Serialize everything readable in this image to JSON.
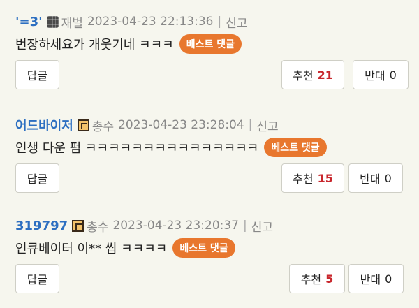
{
  "comments": [
    {
      "nick": "'=3'",
      "level_icon": "dark-grid-icon",
      "grade": "재벌",
      "date": "2023-04-23 22:13:36",
      "report": "신고",
      "text": "번장하세요가 개웃기네 ㅋㅋㅋ",
      "badge": "베스트 댓글",
      "reply": "답글",
      "up_label": "추천",
      "up_count": "21",
      "down_label": "반대",
      "down_count": "0"
    },
    {
      "nick": "어드바이저",
      "level_icon": "square-bracket-icon",
      "grade": "총수",
      "date": "2023-04-23 23:28:04",
      "report": "신고",
      "text": "인생 다운 펌 ㅋㅋㅋㅋㅋㅋㅋㅋㅋㅋㅋㅋㅋㅋㅋ",
      "badge": "베스트 댓글",
      "reply": "답글",
      "up_label": "추천",
      "up_count": "15",
      "down_label": "반대",
      "down_count": "0"
    },
    {
      "nick": "319797",
      "level_icon": "square-bracket-icon",
      "grade": "총수",
      "date": "2023-04-23 23:20:37",
      "report": "신고",
      "text": "인큐베이터 이** 씹 ㅋㅋㅋㅋ",
      "badge": "베스트 댓글",
      "reply": "답글",
      "up_label": "추천",
      "up_count": "5",
      "down_label": "반대",
      "down_count": "0"
    }
  ],
  "colors": {
    "background": "#f6f6ee",
    "nick": "#2d6fc1",
    "badge": "#e8772e",
    "up_count": "#c8262c"
  }
}
